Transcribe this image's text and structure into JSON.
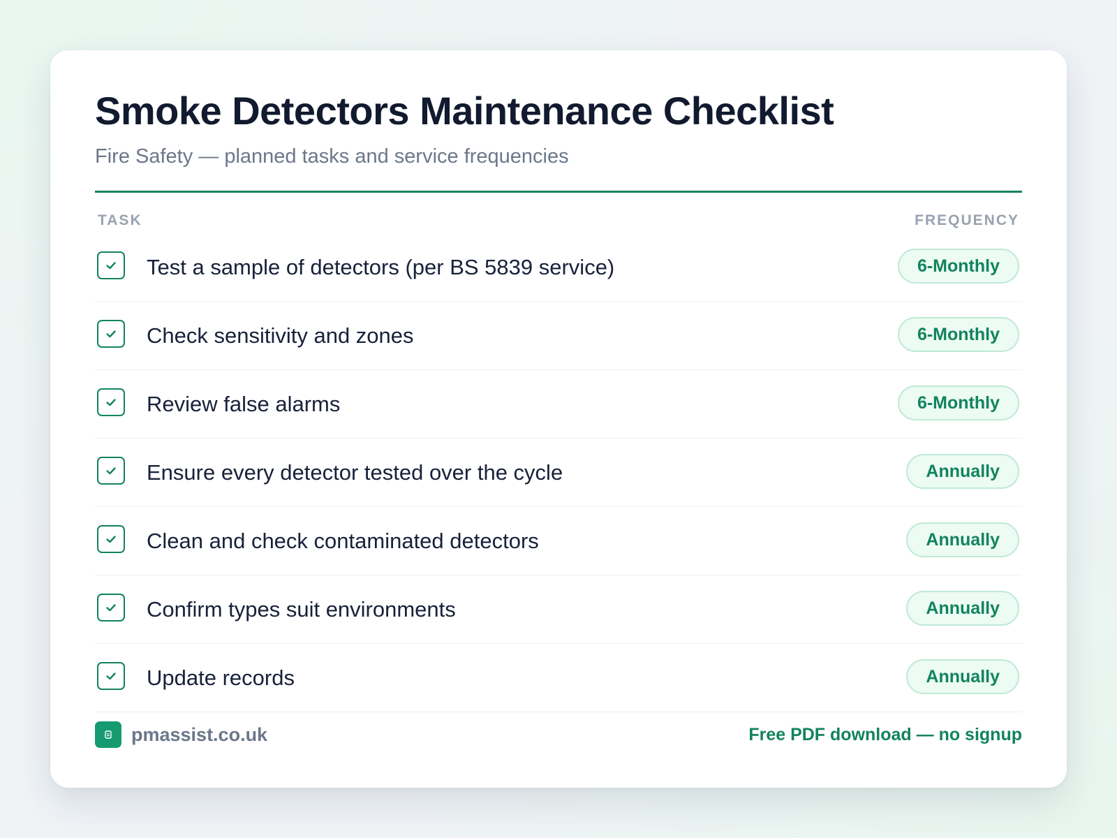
{
  "colors": {
    "accent": "#12835d",
    "badge_background": "#ecfbf3",
    "badge_border": "#bfe9d6",
    "title": "#111a2e",
    "muted": "#6b778a"
  },
  "header": {
    "title": "Smoke Detectors Maintenance Checklist",
    "subtitle": "Fire Safety — planned tasks and service frequencies"
  },
  "table": {
    "columns": {
      "task": "TASK",
      "frequency": "FREQUENCY"
    },
    "rows": [
      {
        "task": "Test a sample of detectors (per BS 5839 service)",
        "frequency": "6-Monthly",
        "checked": true,
        "icon": "check-icon"
      },
      {
        "task": "Check sensitivity and zones",
        "frequency": "6-Monthly",
        "checked": true,
        "icon": "check-icon"
      },
      {
        "task": "Review false alarms",
        "frequency": "6-Monthly",
        "checked": true,
        "icon": "check-icon"
      },
      {
        "task": "Ensure every detector tested over the cycle",
        "frequency": "Annually",
        "checked": true,
        "icon": "check-icon"
      },
      {
        "task": "Clean and check contaminated detectors",
        "frequency": "Annually",
        "checked": true,
        "icon": "check-icon"
      },
      {
        "task": "Confirm types suit environments",
        "frequency": "Annually",
        "checked": true,
        "icon": "check-icon"
      },
      {
        "task": "Update records",
        "frequency": "Annually",
        "checked": true,
        "icon": "check-icon"
      }
    ]
  },
  "footer": {
    "brand_icon": "document-icon",
    "brand": "pmassist.co.uk",
    "download_label": "Free PDF download — no signup"
  }
}
